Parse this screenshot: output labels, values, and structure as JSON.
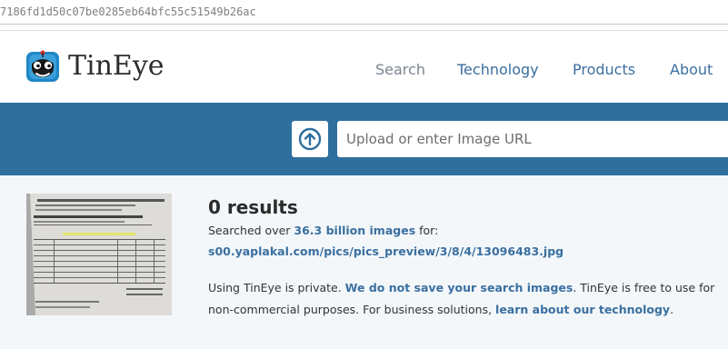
{
  "browser": {
    "hash_text": "7186fd1d50c07be0285eb64bfc55c51549b26ac"
  },
  "header": {
    "logo_text": "TinEye",
    "nav": {
      "search": "Search",
      "technology": "Technology",
      "products": "Products",
      "about": "About"
    }
  },
  "search": {
    "upload_icon": "upload-arrow-icon",
    "placeholder": "Upload or enter Image URL"
  },
  "results": {
    "count_text": "0 results",
    "searched_prefix": "Searched over ",
    "searched_link": "36.3 billion images",
    "searched_suffix": " for:",
    "query_url": "s00.yaplakal.com/pics/pics_preview/3/8/4/13096483.jpg",
    "privacy_line1_prefix": "Using TinEye is private. ",
    "privacy_line1_link": "We do not save your search images",
    "privacy_line1_suffix": ". TinEye is free to use for",
    "privacy_line2_prefix": "non-commercial purposes. For business solutions, ",
    "privacy_line2_link": "learn about our technology",
    "privacy_line2_suffix": "."
  },
  "colors": {
    "band_blue": "#2f6f9e",
    "link_blue": "#3a6fa0",
    "results_bg": "#f3f7fa"
  }
}
